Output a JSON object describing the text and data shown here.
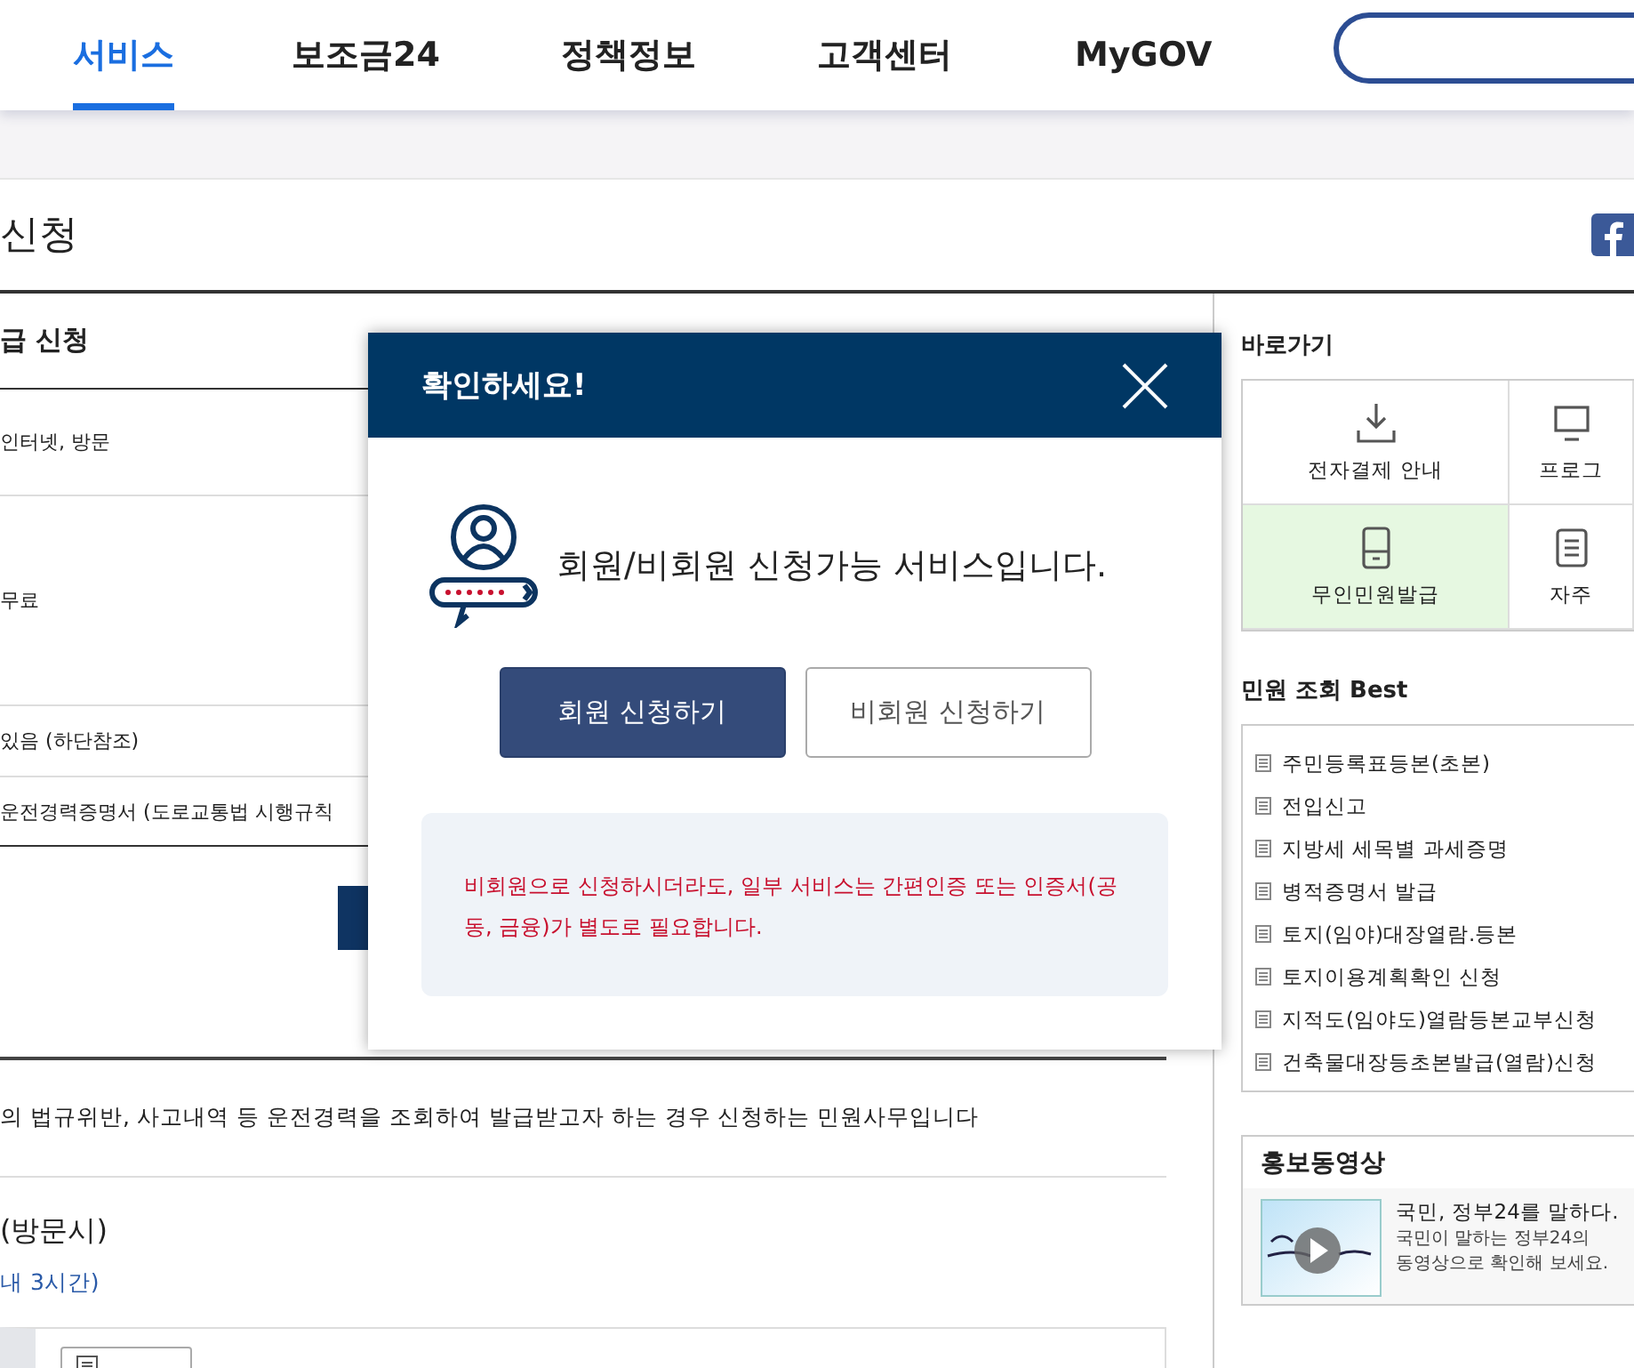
{
  "nav": {
    "tabs": [
      {
        "label": "서비스",
        "selected": true
      },
      {
        "label": "보조금24",
        "selected": false
      },
      {
        "label": "정책정보",
        "selected": false
      },
      {
        "label": "고객센터",
        "selected": false
      },
      {
        "label": "MyGOV",
        "selected": false
      }
    ]
  },
  "page": {
    "title": "신청"
  },
  "apply_section": {
    "heading": "급 신청",
    "rows": [
      "인터넷, 방문",
      "무료",
      "있음 (하단참조)",
      "운전경력증명서 (도로교통법 시행규칙"
    ]
  },
  "description": "의 법규위반, 사고내역 등 운전경력을 조회하여 발급받고자 하는 경우 신청하는 민원사무입니다",
  "visit_section": {
    "heading": "(방문시)",
    "note": "내 3시간)"
  },
  "shortcuts": {
    "heading": "바로가기",
    "items": [
      {
        "label": "전자결제 안내",
        "kind": "download",
        "selected": false
      },
      {
        "label": "프로그",
        "kind": "monitor",
        "selected": false
      },
      {
        "label": "무인민원발급",
        "kind": "kiosk",
        "selected": true
      },
      {
        "label": "자주",
        "kind": "document",
        "selected": false
      }
    ]
  },
  "best": {
    "heading": "민원 조회 Best",
    "items": [
      "주민등록표등본(초본)",
      "전입신고",
      "지방세 세목별 과세증명",
      "병적증명서 발급",
      "토지(임야)대장열람.등본",
      "토지이용계획확인 신청",
      "지적도(임야도)열람등본교부신청",
      "건축물대장등초본발급(열람)신청"
    ]
  },
  "promo": {
    "heading": "홍보동영상",
    "video": {
      "kind": "picture",
      "title": "국민, 정부24를 말하다.",
      "lines": [
        "국민이 말하는 정부24의",
        "동영상으로 확인해 보세요."
      ]
    }
  },
  "modal": {
    "title": "확인하세요!",
    "message": "회원/비회원 신청가능 서비스입니다.",
    "buttons": [
      {
        "label": "회원 신청하기",
        "kind": "primary"
      },
      {
        "label": "비회원 신청하기",
        "kind": "secondary"
      }
    ],
    "notice": "비회원으로 신청하시더라도, 일부 서비스는 간편인증 또는 인증서(공동, 금융)가 별도로 필요합니다."
  }
}
